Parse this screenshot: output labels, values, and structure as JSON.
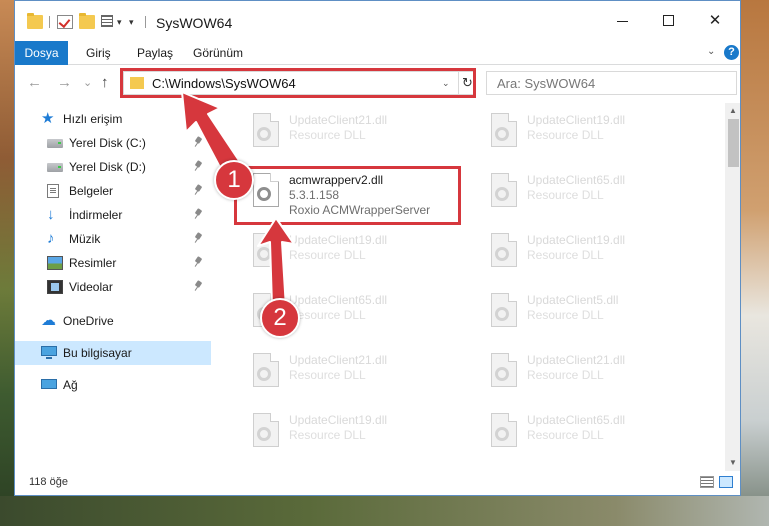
{
  "window": {
    "title": "SysWOW64",
    "minimize_glyph": "",
    "close_glyph": "✕"
  },
  "ribbon": {
    "tabs": [
      "Dosya",
      "Giriş",
      "Paylaş",
      "Görünüm"
    ],
    "help": "?"
  },
  "navbar": {
    "back": "←",
    "forward": "→",
    "recent": "⌄",
    "up": "↑",
    "address": "C:\\Windows\\SysWOW64",
    "refresh": "↻",
    "search_placeholder": "Ara: SysWOW64"
  },
  "sidebar": {
    "items": [
      {
        "label": "Hızlı erişim",
        "icon": "star-icon",
        "pinned": false
      },
      {
        "label": "Yerel Disk (C:)",
        "icon": "drive-icon",
        "pinned": true
      },
      {
        "label": "Yerel Disk (D:)",
        "icon": "drive-icon",
        "pinned": true
      },
      {
        "label": "Belgeler",
        "icon": "document-icon",
        "pinned": true
      },
      {
        "label": "İndirmeler",
        "icon": "download-icon",
        "pinned": true
      },
      {
        "label": "Müzik",
        "icon": "music-icon",
        "pinned": true
      },
      {
        "label": "Resimler",
        "icon": "pictures-icon",
        "pinned": true
      },
      {
        "label": "Videolar",
        "icon": "video-icon",
        "pinned": true
      },
      {
        "label": "OneDrive",
        "icon": "cloud-icon",
        "pinned": false
      },
      {
        "label": "Bu bilgisayar",
        "icon": "computer-icon",
        "pinned": false,
        "selected": true
      },
      {
        "label": "Ağ",
        "icon": "network-icon",
        "pinned": false
      }
    ]
  },
  "files": {
    "col1": [
      {
        "name": "UpdateClient21.dll",
        "desc": "Resource DLL"
      },
      {
        "name": "acmwrapperv2.dll",
        "version": "5.3.1.158",
        "desc": "Roxio ACMWrapperServer",
        "focused": true
      },
      {
        "name": "UpdateClient19.dll",
        "desc": "Resource DLL"
      },
      {
        "name": "UpdateClient65.dll",
        "desc": "Resource DLL"
      },
      {
        "name": "UpdateClient21.dll",
        "desc": "Resource DLL"
      },
      {
        "name": "UpdateClient19.dll",
        "desc": "Resource DLL"
      }
    ],
    "col2": [
      {
        "name": "UpdateClient19.dll",
        "desc": "Resource DLL"
      },
      {
        "name": "UpdateClient65.dll",
        "desc": "Resource DLL"
      },
      {
        "name": "UpdateClient19.dll",
        "desc": "Resource DLL"
      },
      {
        "name": "UpdateClient5.dll",
        "desc": "Resource DLL"
      },
      {
        "name": "UpdateClient21.dll",
        "desc": "Resource DLL"
      },
      {
        "name": "UpdateClient65.dll",
        "desc": "Resource DLL"
      }
    ]
  },
  "status": {
    "count": "118 öğe"
  },
  "callouts": [
    "1",
    "2"
  ],
  "colors": {
    "accent": "#1979ca",
    "highlight": "#d6373d",
    "selected": "#cce8ff"
  }
}
